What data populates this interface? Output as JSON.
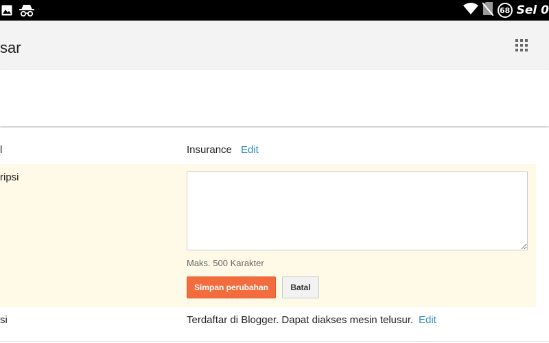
{
  "status_bar": {
    "left_icons": [
      "image-icon",
      "incognito-icon"
    ],
    "right_icons": [
      "wifi-icon",
      "no-sim-icon"
    ],
    "badge": "68",
    "carrier": "Sel 0"
  },
  "app_bar": {
    "title": "sar",
    "menu_icon": "apps-grid-icon"
  },
  "rows": {
    "title": {
      "label": "l",
      "value": "Insurance",
      "link": "Edit"
    },
    "description": {
      "label": "ripsi",
      "textarea_value": "",
      "hint": "Maks. 500 Karakter",
      "save_label": "Simpan perubahan",
      "cancel_label": "Batal"
    },
    "privacy": {
      "label": "si",
      "value": "Terdaftar di Blogger. Dapat diakses mesin telusur.",
      "link": "Edit"
    }
  },
  "colors": {
    "accent": "#f36c3d",
    "link": "#2a8cc1",
    "highlight_bg": "#fffae8",
    "statusbar_bg": "#000000"
  }
}
